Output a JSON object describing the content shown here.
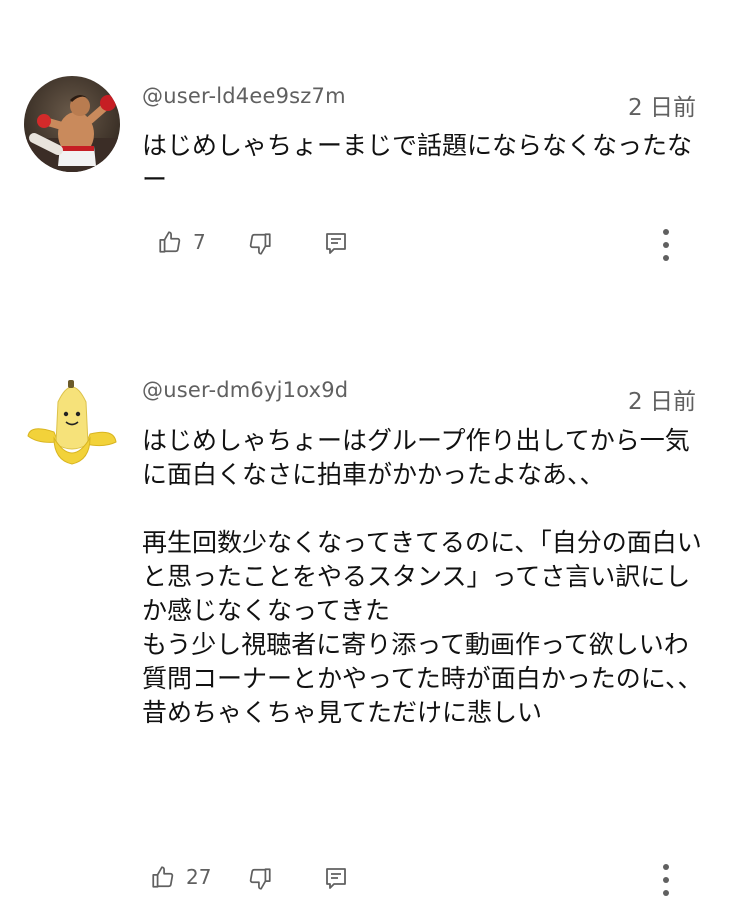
{
  "comments": [
    {
      "author": "@user-ld4ee9sz7m",
      "time": "2 日前",
      "text": "はじめしゃちょーまじで話題にならなくなったなー",
      "likes": "7",
      "avatar": "boxer-photo"
    },
    {
      "author": "@user-dm6yj1ox9d",
      "time": "2 日前",
      "text": "はじめしゃちょーはグループ作り出してから一気に面白くなさに拍車がかかったよなあ、、\n\n再生回数少なくなってきてるのに、「自分の面白いと思ったことをやるスタンス」ってさ言い訳にしか感じなくなってきた\nもう少し視聴者に寄り添って動画作って欲しいわ\n質問コーナーとかやってた時が面白かったのに、、\n昔めちゃくちゃ見てただけに悲しい",
      "likes": "27",
      "avatar": "banana-plush"
    }
  ],
  "icons": {
    "like": "thumbs-up-icon",
    "dislike": "thumbs-down-icon",
    "reply": "reply-comment-icon",
    "menu": "more-vertical-icon"
  },
  "colors": {
    "text": "#0f0f0f",
    "meta": "#606060",
    "icon": "#606060"
  }
}
